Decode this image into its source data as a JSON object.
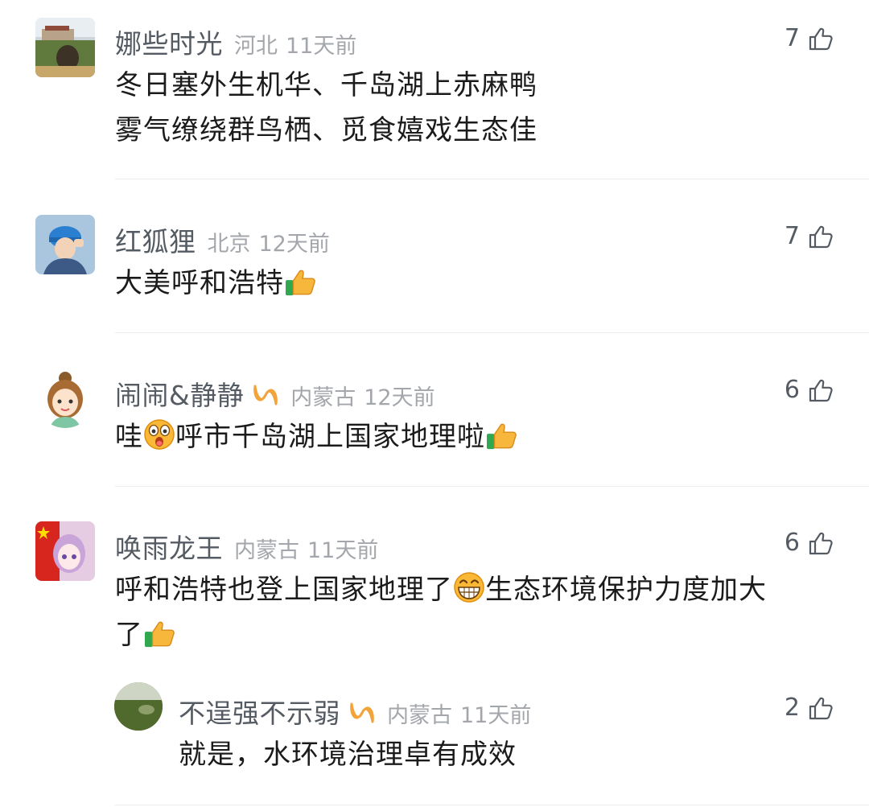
{
  "comments": [
    {
      "username": "娜些时光",
      "location": "河北",
      "time": "11天前",
      "likes": "7",
      "lines": [
        "冬日塞外生机华、千岛湖上赤麻鸭",
        "雾气缭绕群鸟栖、觅食嬉戏生态佳"
      ]
    },
    {
      "username": "红狐狸",
      "location": "北京",
      "time": "12天前",
      "likes": "7",
      "text": "大美呼和浩特"
    },
    {
      "username": "闹闹&静静",
      "location": "内蒙古",
      "time": "12天前",
      "likes": "6",
      "text_a": "哇",
      "text_b": "呼市千岛湖上国家地理啦"
    },
    {
      "username": "唤雨龙王",
      "location": "内蒙古",
      "time": "11天前",
      "likes": "6",
      "text_a": "呼和浩特也登上国家地理了",
      "text_b": "生态环境保护力度加大",
      "text_c": "了"
    }
  ],
  "reply": {
    "username": "不逞强不示弱",
    "location": "内蒙古",
    "time": "11天前",
    "likes": "2",
    "text": "就是，水环境治理卓有成效"
  },
  "icons": {
    "like": "thumbs-up-outline-icon",
    "vip": "vip-badge-icon",
    "emoji_thumbs": "thumbs-up-emoji",
    "emoji_surprised": "surprised-emoji",
    "emoji_grin": "grinning-emoji"
  },
  "colors": {
    "username": "#555b63",
    "meta": "#a3a6ab",
    "vip": "#f2a33a",
    "text": "#1b1b1b"
  }
}
